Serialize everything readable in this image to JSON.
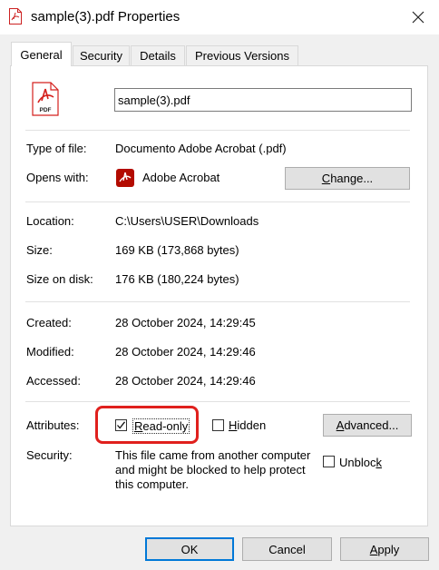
{
  "window": {
    "title": "sample(3).pdf Properties",
    "close_icon": "close-icon",
    "file_icon": "pdf-file-icon"
  },
  "tabs": [
    {
      "label": "General",
      "active": true
    },
    {
      "label": "Security",
      "active": false
    },
    {
      "label": "Details",
      "active": false
    },
    {
      "label": "Previous Versions",
      "active": false
    }
  ],
  "general": {
    "file_name": "sample(3).pdf",
    "big_icon_text": "PDF",
    "type_label": "Type of file:",
    "type_value": "Documento Adobe Acrobat (.pdf)",
    "opens_label": "Opens with:",
    "opens_value": "Adobe Acrobat",
    "change_button": "Change...",
    "location_label": "Location:",
    "location_value": "C:\\Users\\USER\\Downloads",
    "size_label": "Size:",
    "size_value": "169 KB (173,868 bytes)",
    "size_on_disk_label": "Size on disk:",
    "size_on_disk_value": "176 KB (180,224 bytes)",
    "created_label": "Created:",
    "created_value": "28 October 2024, 14:29:45",
    "modified_label": "Modified:",
    "modified_value": "28 October 2024, 14:29:46",
    "accessed_label": "Accessed:",
    "accessed_value": "28 October 2024, 14:29:46",
    "attributes_label": "Attributes:",
    "readonly_label": "Read-only",
    "readonly_checked": true,
    "hidden_label": "Hidden",
    "hidden_checked": false,
    "advanced_button": "Advanced...",
    "security_label": "Security:",
    "security_text_1": "This file came from another computer",
    "security_text_2": "and might be blocked to help protect",
    "security_text_3": "this computer.",
    "unblock_label": "Unblock",
    "unblock_checked": false
  },
  "footer": {
    "ok": "OK",
    "cancel": "Cancel",
    "apply": "Apply"
  },
  "colors": {
    "accent": "#0078d7",
    "pdf_red": "#d4201d",
    "highlight": "#e0201d"
  }
}
